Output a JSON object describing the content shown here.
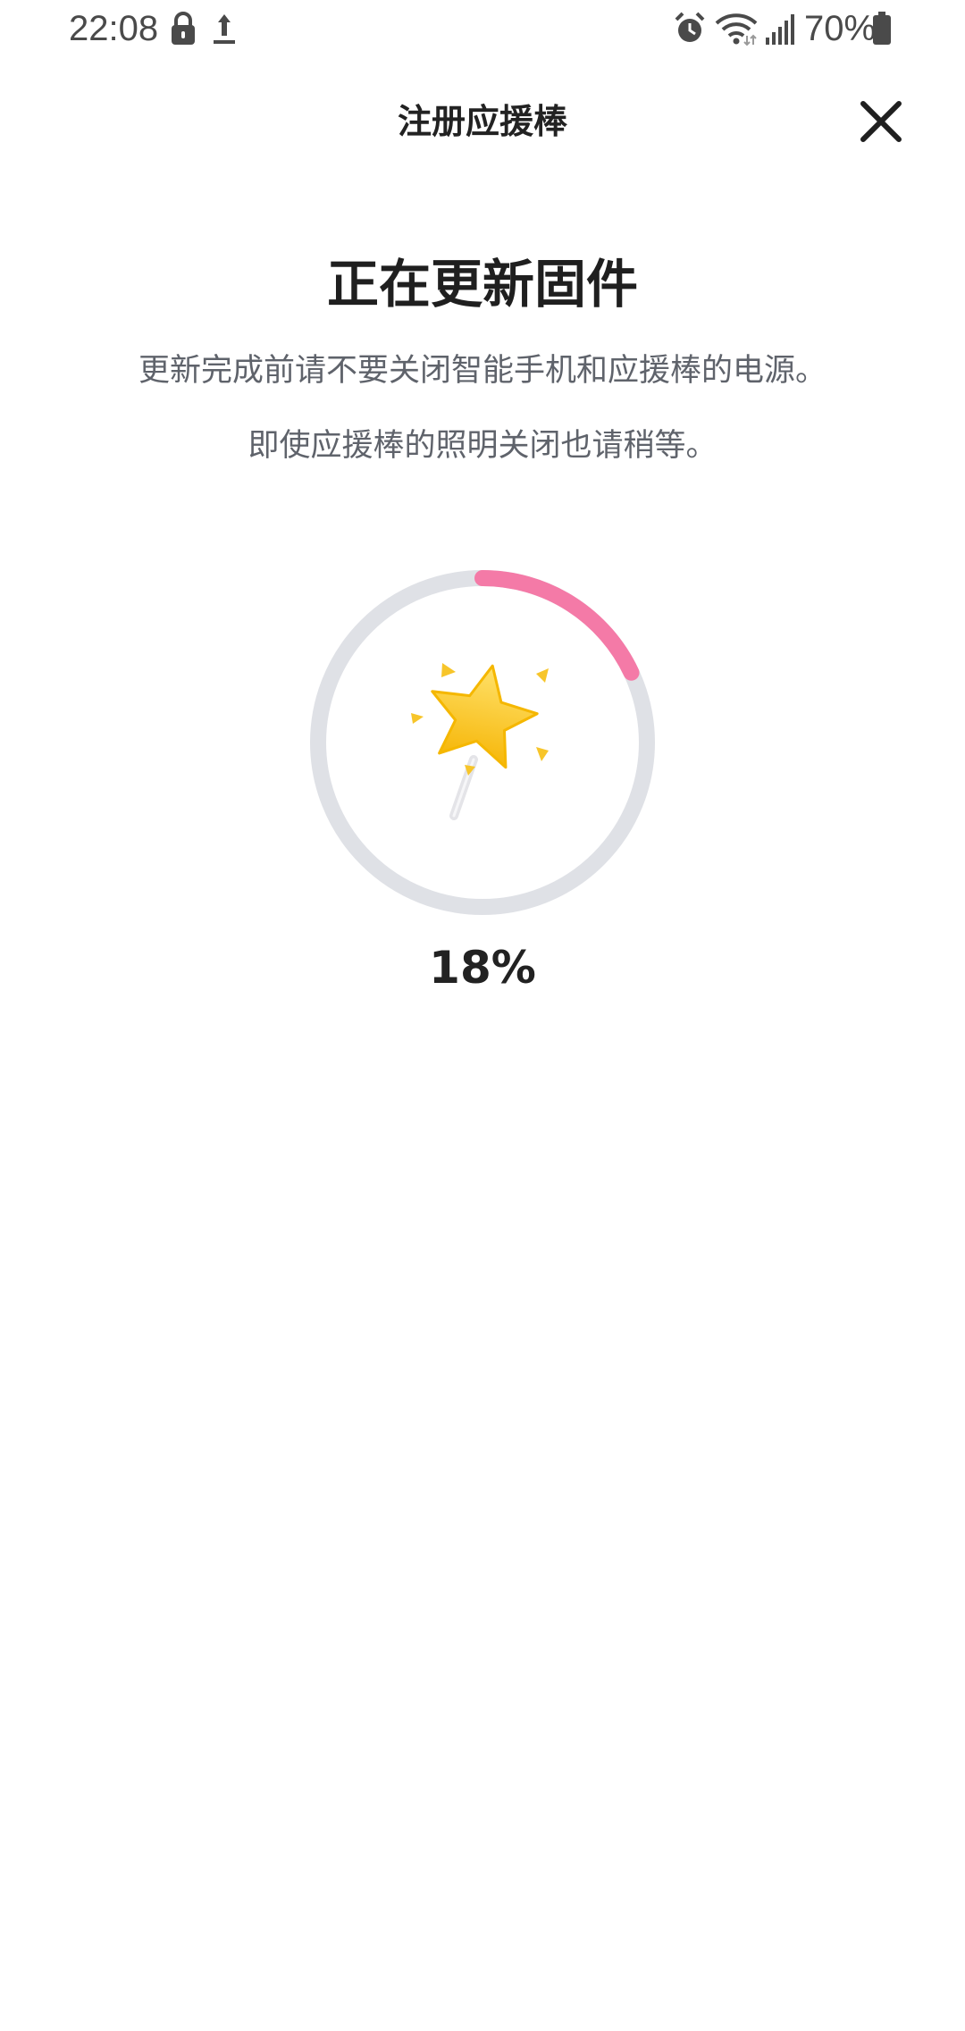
{
  "status_bar": {
    "time": "22:08",
    "battery_text": "70%",
    "icons": [
      "lock-icon",
      "upload-icon",
      "alarm-icon",
      "wifi-icon",
      "signal-icon",
      "battery-icon"
    ]
  },
  "header": {
    "title": "注册应援棒",
    "close_icon": "close-icon"
  },
  "update": {
    "title": "正在更新固件",
    "description_line1": "更新完成前请不要关闭智能手机和应援棒的电源。",
    "description_line2": "即使应援棒的照明关闭也请稍等。",
    "progress_value": 0.18,
    "progress_label": "18%",
    "illustration_icon": "star-wand-icon"
  },
  "colors": {
    "progress_fill": "#f47aa7",
    "progress_track": "#dfe1e6",
    "star": "#ffc91d",
    "text_primary": "#1f1f1f",
    "text_secondary": "#5f636b"
  }
}
